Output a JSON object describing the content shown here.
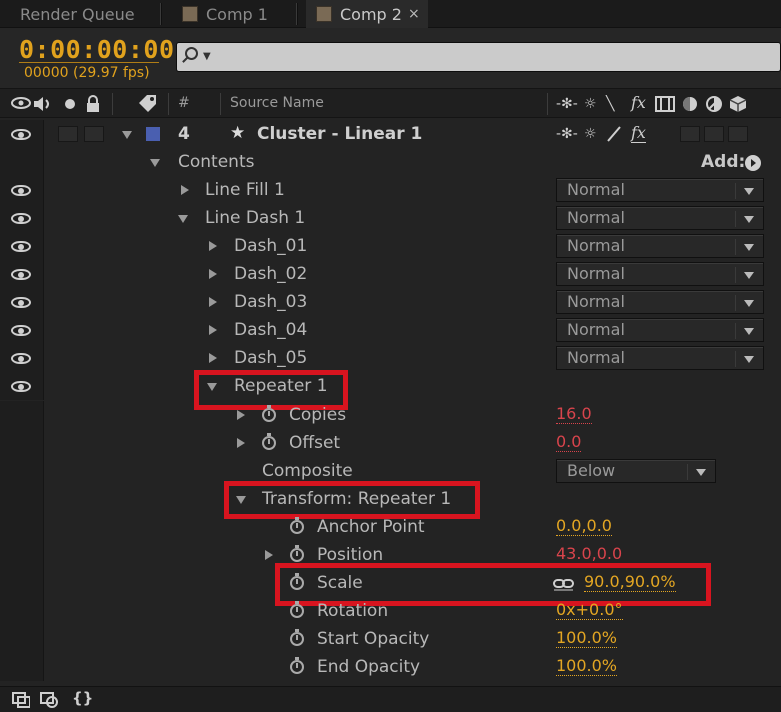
{
  "tabs": [
    {
      "label": "Render Queue"
    },
    {
      "label": "Comp 1"
    },
    {
      "label": "Comp 2",
      "close": "×"
    }
  ],
  "header": {
    "timecode": "0:00:00:00",
    "fps": "00000 (29.97 fps)",
    "search_placeholder": ""
  },
  "columns": {
    "number": "#",
    "source_name": "Source Name",
    "fx": "fx"
  },
  "layer": {
    "number": "4",
    "name": "Cluster - Linear 1",
    "label_color": "#4a5fb0",
    "fx": "fx"
  },
  "contents": {
    "label": "Contents",
    "add_label": "Add:"
  },
  "rows": {
    "line_fill": "Line Fill 1",
    "line_dash": "Line Dash 1",
    "dash_01": "Dash_01",
    "dash_02": "Dash_02",
    "dash_03": "Dash_03",
    "dash_04": "Dash_04",
    "dash_05": "Dash_05",
    "repeater": "Repeater 1",
    "copies": "Copies",
    "copies_val": "16.0",
    "offset": "Offset",
    "offset_val": "0.0",
    "composite": "Composite",
    "composite_val": "Below",
    "transform": "Transform: Repeater 1",
    "anchor": "Anchor Point",
    "anchor_val": "0.0,0.0",
    "position": "Position",
    "position_val": "43.0,0.0",
    "scale": "Scale",
    "scale_val": "90.0,90.0%",
    "rotation": "Rotation",
    "rotation_val": "0x+0.0°",
    "start_opacity": "Start Opacity",
    "start_opacity_val": "100.0%",
    "end_opacity": "End Opacity",
    "end_opacity_val": "100.0%"
  },
  "blend_mode": "Normal",
  "colors": {
    "timecode": "#e1a21d",
    "value_red": "#d8444c",
    "value_orange": "#e3a623",
    "highlight": "#d8141f"
  },
  "icons": [
    "eye-icon",
    "speaker-icon",
    "solo-icon",
    "lock-icon",
    "label-tag-icon",
    "stopwatch-icon",
    "link-icon",
    "star-icon",
    "add-arrow-icon",
    "magnifier-icon"
  ]
}
